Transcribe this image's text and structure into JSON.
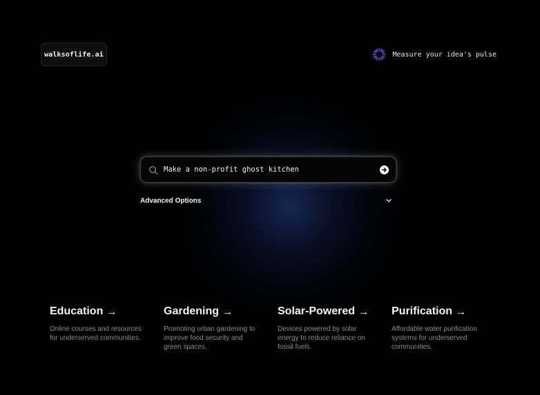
{
  "header": {
    "logo_text": "walksoflife.ai",
    "pulse_label": "Measure your idea's pulse"
  },
  "search": {
    "value": "Make a non-profit ghost kitchen",
    "submit_icon": "arrow-right-circle-icon"
  },
  "advanced": {
    "label": "Advanced Options"
  },
  "categories": [
    {
      "title": "Education",
      "arrow": "→",
      "description": "Online courses and resources for underserved communities."
    },
    {
      "title": "Gardening",
      "arrow": "→",
      "description": "Promoting urban gardening to improve food security and green spaces."
    },
    {
      "title": "Solar-Powered",
      "arrow": "→",
      "description": "Devices powered by solar energy to reduce reliance on fossil fuels."
    },
    {
      "title": "Purification",
      "arrow": "→",
      "description": "Affordable water purification systems for underserved communities."
    }
  ],
  "colors": {
    "background": "#000000",
    "accent_glow": "#284696",
    "pulse_icon": "#6b5cff"
  }
}
